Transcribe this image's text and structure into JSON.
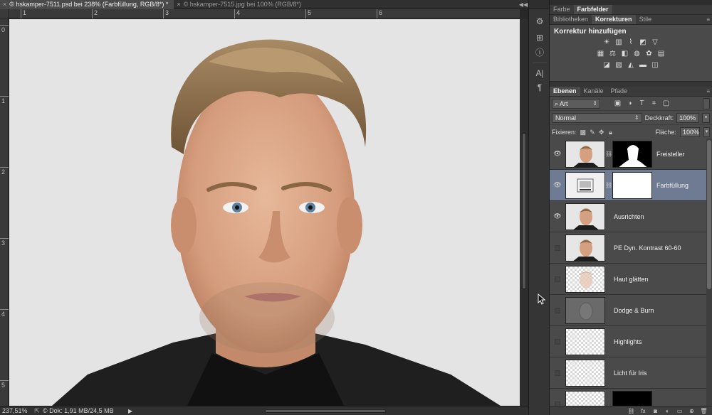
{
  "document_tabs": [
    {
      "close": "×",
      "title": "© hskamper-7511.psd bei 238% (Farbfüllung, RGB/8*) *"
    },
    {
      "close": "×",
      "title": "© hskamper-7515.jpg bei 100% (RGB/8*)"
    }
  ],
  "ruler_h": [
    "1",
    "2",
    "3",
    "4",
    "5",
    "6"
  ],
  "ruler_v": [
    "0",
    "1",
    "2",
    "3",
    "4",
    "5"
  ],
  "status_bar": {
    "zoom": "237,51%",
    "doc_info": "© Dok: 1,91 MB/24,5 MB"
  },
  "color_panel": {
    "tabs": [
      "Farbe",
      "Farbfelder"
    ],
    "active": 1
  },
  "adjust_panel": {
    "tabs": [
      "Bibliotheken",
      "Korrekturen",
      "Stile"
    ],
    "active": 1,
    "title": "Korrektur hinzufügen",
    "icons_row1": [
      "brightness-icon",
      "levels-icon",
      "curves-icon",
      "exposure-icon",
      "vibrance-icon"
    ],
    "icons_row2": [
      "hue-saturation-icon",
      "color-balance-icon",
      "black-white-icon",
      "photo-filter-icon",
      "channel-mixer-icon",
      "color-lookup-icon"
    ],
    "icons_row3": [
      "invert-icon",
      "posterize-icon",
      "threshold-icon",
      "gradient-map-icon",
      "selective-color-icon"
    ]
  },
  "layers_panel": {
    "tabs": [
      "Ebenen",
      "Kanäle",
      "Pfade"
    ],
    "active": 0,
    "filter_value": "⌕ Art",
    "blend_mode": "Normal",
    "opacity_label": "Deckkraft:",
    "opacity_value": "100%",
    "lock_label": "Fixieren:",
    "fill_label": "Fläche:",
    "fill_value": "100%",
    "layers": [
      {
        "name": "Freisteller",
        "visible": true,
        "thumb": "face",
        "mask": "silhouette",
        "selected": false
      },
      {
        "name": "Farbfüllung",
        "visible": true,
        "thumb": "fill",
        "mask": "white",
        "selected": true
      },
      {
        "name": "Ausrichten",
        "visible": true,
        "thumb": "face",
        "mask": "",
        "selected": false
      },
      {
        "name": "PE Dyn. Kontrast 60-60",
        "visible": false,
        "thumb": "face",
        "mask": "",
        "selected": false
      },
      {
        "name": "Haut glätten",
        "visible": false,
        "thumb": "face-faint",
        "mask": "",
        "selected": false
      },
      {
        "name": "Dodge & Burn",
        "visible": false,
        "thumb": "gray",
        "mask": "",
        "selected": false
      },
      {
        "name": "Highlights",
        "visible": false,
        "thumb": "checker",
        "mask": "",
        "selected": false
      },
      {
        "name": "Licht für Iris",
        "visible": false,
        "thumb": "checker",
        "mask": "",
        "selected": false
      },
      {
        "name": "",
        "visible": false,
        "thumb": "checker",
        "mask": "black",
        "selected": false
      }
    ]
  },
  "footer_icons": [
    "link-icon",
    "fx-icon",
    "mask-icon",
    "adjustment-icon",
    "group-icon",
    "new-layer-icon",
    "trash-icon"
  ],
  "colors": {
    "selected_layer": "#6f7b92",
    "panel_bg": "#4a4a4a",
    "canvas_bg": "#e4e4e4"
  }
}
